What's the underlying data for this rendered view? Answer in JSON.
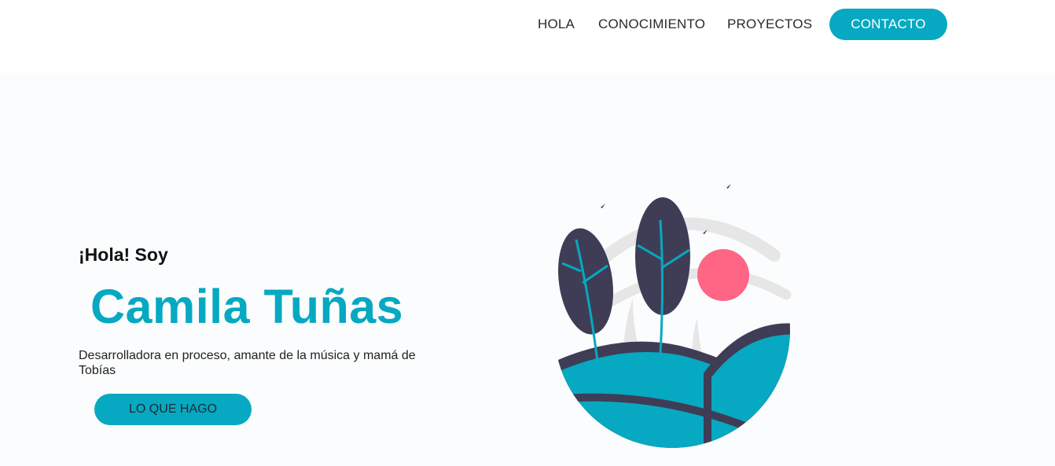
{
  "nav": {
    "links": [
      {
        "label": "HOLA"
      },
      {
        "label": "CONOCIMIENTO"
      },
      {
        "label": "PROYECTOS"
      }
    ],
    "contact_label": "CONTACTO"
  },
  "hero": {
    "greeting": "¡Hola! Soy",
    "name": "Camila Tuñas",
    "tagline": "Desarrolladora en proceso, amante de la música y mamá de Tobías",
    "cta_label": "LO QUE HAGO"
  },
  "colors": {
    "accent": "#06a9c1",
    "dark": "#3f3d56",
    "sun": "#ff6584",
    "background": "#fbfcfd"
  },
  "illustration": {
    "icon": "landscape-illustration"
  }
}
